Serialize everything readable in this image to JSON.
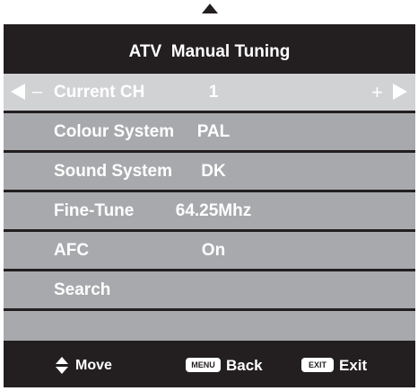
{
  "menu": {
    "title": "ATV  Manual Tuning",
    "rows": [
      {
        "label": "Current CH",
        "value": "1",
        "left_symbol": "–",
        "right_symbol": "+"
      },
      {
        "label": "Colour System",
        "value": "PAL"
      },
      {
        "label": "Sound System",
        "value": "DK"
      },
      {
        "label": "Fine-Tune",
        "value": "64.25Mhz"
      },
      {
        "label": "AFC",
        "value": "On"
      },
      {
        "label": "Search",
        "value": ""
      }
    ]
  },
  "footer": {
    "move_label": "Move",
    "menu_key": "MENU",
    "back_label": "Back",
    "exit_key": "EXIT",
    "exit_label": "Exit"
  },
  "colors": {
    "panel": "#231f20",
    "row": "#a7a9ac",
    "row_selected": "#d1d2d4",
    "text": "#ffffff"
  },
  "icons": [
    "scroll-up-icon",
    "left-arrow-icon",
    "right-arrow-icon",
    "up-down-icon"
  ]
}
